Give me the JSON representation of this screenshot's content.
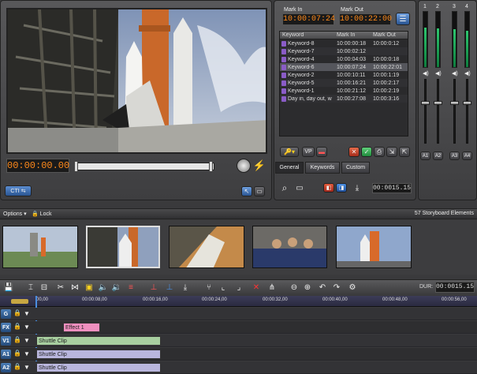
{
  "viewer": {
    "timecode": "00:00:00.00",
    "toggle_label": "CTI",
    "lightning_icon": "lightning-icon"
  },
  "marks": {
    "mark_in_label": "Mark In",
    "mark_out_label": "Mark Out",
    "mark_in_value": "10:00:07:24",
    "mark_out_value": "10:00:22:00"
  },
  "keywords": {
    "columns": [
      "Keyword",
      "Mark In",
      "Mark Out"
    ],
    "rows": [
      {
        "keyword": "Keyword-8",
        "in": "10:00:00:18",
        "out": "10:00:0:12"
      },
      {
        "keyword": "Keyword-7",
        "in": "10:00:02:12",
        "out": ""
      },
      {
        "keyword": "Keyword-4",
        "in": "10:00:04:03",
        "out": "10:00:0:18"
      },
      {
        "keyword": "Keyword-6",
        "in": "10:00:07:24",
        "out": "10:00:22:01"
      },
      {
        "keyword": "Keyword-2",
        "in": "10:00:10:11",
        "out": "10:00:1:19"
      },
      {
        "keyword": "Keyword-5",
        "in": "10:00:16:21",
        "out": "10:00:2:17"
      },
      {
        "keyword": "Keyword-1",
        "in": "10:00:21:12",
        "out": "10:00:2:19"
      },
      {
        "keyword": "Day in, day out, w",
        "in": "10:00:27:08",
        "out": "10:00:3:16"
      }
    ],
    "tabs": [
      "General",
      "Keywords",
      "Custom"
    ],
    "duration": "00:0015.15"
  },
  "audio": {
    "channels": [
      "1",
      "2",
      "3",
      "4"
    ],
    "labels": [
      "A1",
      "A2",
      "A3",
      "A4"
    ],
    "levels": [
      0.72,
      0.7,
      0.68,
      0.66
    ]
  },
  "storyboard": {
    "options_label": "Options",
    "lock_label": "Lock",
    "count": "57 Storyboard Elements"
  },
  "timeline": {
    "dur_label": "DUR:",
    "dur_value": "00:0015.15",
    "ruler": [
      "00,00",
      "00:00:08,00",
      "00:00:16,00",
      "00:00:24,00",
      "00:00:32,00",
      "00:00:40,00",
      "00:00:48,00",
      "00:00:56,00"
    ],
    "tracks": [
      {
        "label": "G",
        "clip": ""
      },
      {
        "label": "FX",
        "clip": "Effect 1"
      },
      {
        "label": "V1",
        "clip": "Shuttle Clip"
      },
      {
        "label": "A1",
        "clip": "Shuttle Clip"
      },
      {
        "label": "A2",
        "clip": "Shuttle Clip"
      }
    ]
  },
  "colors": {
    "timecode": "#ff8a1a",
    "meter": "#2ec66f",
    "fx_clip": "#f08fbf",
    "video_clip": "#a8cfa0",
    "audio_clip": "#b9b6dd"
  }
}
